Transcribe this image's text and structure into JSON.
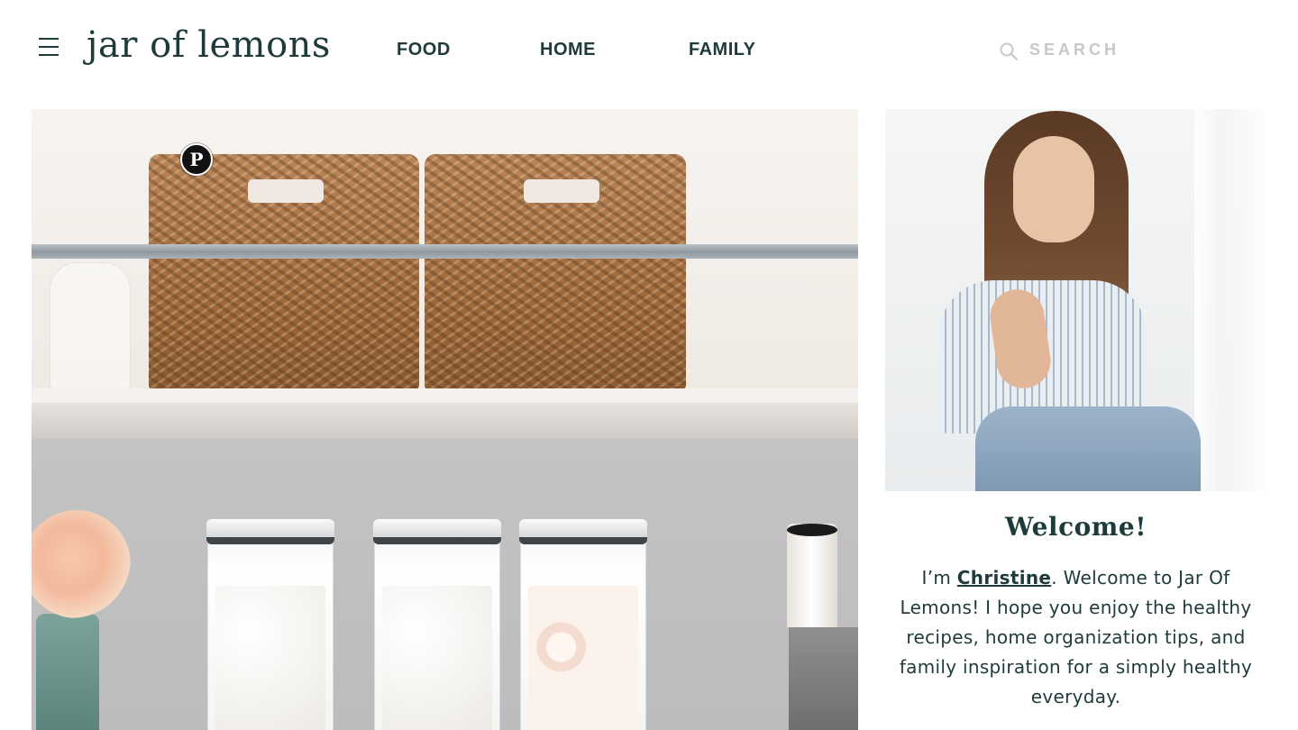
{
  "header": {
    "logo": "jar of lemons",
    "nav": [
      {
        "label": "FOOD"
      },
      {
        "label": "HOME"
      },
      {
        "label": "FAMILY"
      }
    ],
    "search_placeholder": "SEARCH",
    "icons": {
      "menu": "hamburger-menu-icon",
      "search": "search-icon"
    }
  },
  "hero": {
    "image_alt": "laundry room shelves with woven baskets and storage containers",
    "pin_icon": "pinterest-icon",
    "pin_glyph": "P"
  },
  "sidebar": {
    "welcome_title": "Welcome!",
    "intro_prefix": "I’m ",
    "intro_link": "Christine",
    "intro_suffix": ". Welcome to Jar Of Lemons! I hope you enjoy the healthy recipes, home organization tips, and family inspiration for a simply healthy everyday."
  },
  "colors": {
    "text": "#1f3a3a",
    "search_placeholder": "#c4c8cb",
    "background": "#ffffff"
  }
}
